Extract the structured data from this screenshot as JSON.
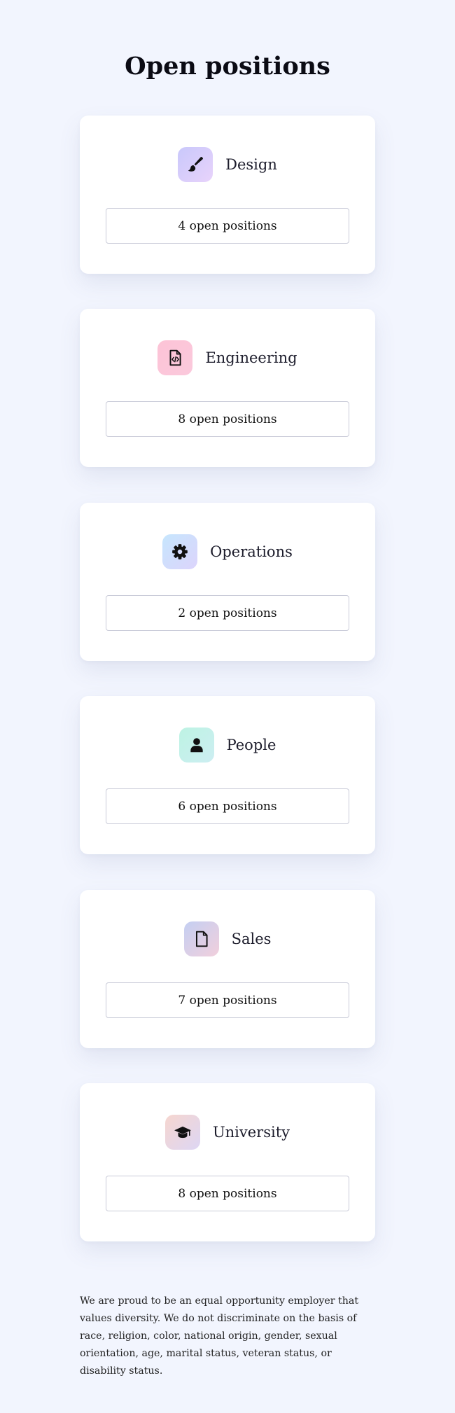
{
  "page": {
    "title": "Open positions"
  },
  "departments": [
    {
      "name": "Design",
      "positions_label": "4 open positions",
      "icon": "paintbrush-icon",
      "gradient": [
        "#c9c8fb",
        "#e8d3fb"
      ]
    },
    {
      "name": "Engineering",
      "positions_label": "8 open positions",
      "icon": "code-file-icon",
      "gradient": [
        "#fcc3d6",
        "#fbc9dc"
      ]
    },
    {
      "name": "Operations",
      "positions_label": "2 open positions",
      "icon": "gear-icon",
      "gradient": [
        "#c6e6fd",
        "#dcd4fc"
      ]
    },
    {
      "name": "People",
      "positions_label": "6 open positions",
      "icon": "user-icon",
      "gradient": [
        "#bdf3e3",
        "#cdeef2"
      ]
    },
    {
      "name": "Sales",
      "positions_label": "7 open positions",
      "icon": "document-icon",
      "gradient": [
        "#c4cff2",
        "#f1cfdc"
      ]
    },
    {
      "name": "University",
      "positions_label": "8 open positions",
      "icon": "graduation-cap-icon",
      "gradient": [
        "#f6d6cf",
        "#ddd6f4"
      ]
    }
  ],
  "footer": {
    "disclaimer": "We are proud to be an equal opportunity employer that values diversity. We do not discriminate on the basis of race, religion, color, national origin, gender, sexual orientation, age, marital status, veteran status, or disability status."
  }
}
